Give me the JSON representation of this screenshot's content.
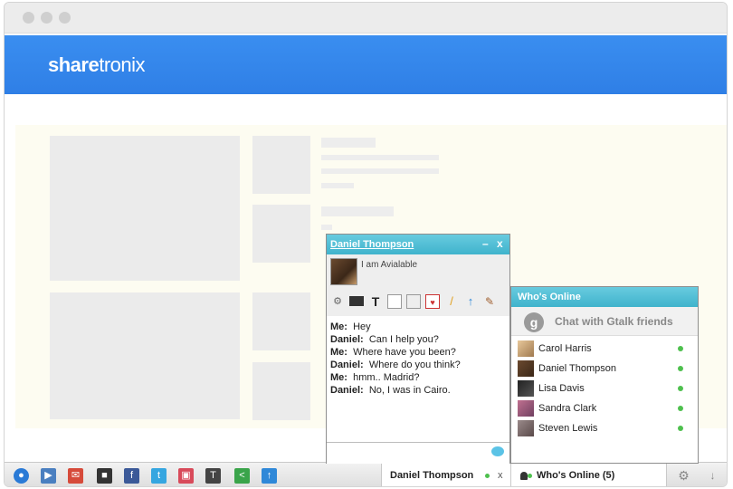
{
  "header": {
    "logo_bold": "share",
    "logo_light": "tronix"
  },
  "chat": {
    "contact_name": "Daniel Thompson",
    "minimize_label": "–",
    "close_label": "x",
    "status": "I am Avialable",
    "toolbar_icons": [
      "settings-icon",
      "screen-icon",
      "font-icon",
      "note-icon",
      "clipboard-icon",
      "card-icon",
      "pencil-icon",
      "upload-icon",
      "broom-icon"
    ],
    "messages": [
      {
        "sender": "Me:",
        "text": "Hey"
      },
      {
        "sender": "Daniel:",
        "text": "Can I help you?"
      },
      {
        "sender": "Me:",
        "text": "Where have you been?"
      },
      {
        "sender": "Daniel:",
        "text": "Where do you think?"
      },
      {
        "sender": "Me:",
        "text": "hmm.. Madrid?"
      },
      {
        "sender": "Daniel:",
        "text": "No, I was in Cairo."
      }
    ]
  },
  "online": {
    "title": "Who's Online",
    "gtalk_icon_letter": "g",
    "gtalk_label": "Chat with Gtalk friends",
    "friends": [
      {
        "name": "Carol Harris"
      },
      {
        "name": "Daniel Thompson"
      },
      {
        "name": "Lisa Davis"
      },
      {
        "name": "Sandra Clark"
      },
      {
        "name": "Steven Lewis"
      }
    ]
  },
  "bottombar": {
    "daniel_tab": "Daniel Thompson",
    "daniel_tab_close": "x",
    "online_tab": "Who's Online (5)",
    "icons": [
      "globe-icon",
      "video-icon",
      "megaphone-icon",
      "invader-icon",
      "facebook-icon",
      "twitter-icon",
      "photo-icon",
      "text-icon",
      "share-icon",
      "upload-arrow-icon"
    ]
  },
  "colors": {
    "header_blue": "#2f7fe6",
    "chat_header": "#4ab8d0",
    "online_green": "#4ec04e"
  }
}
